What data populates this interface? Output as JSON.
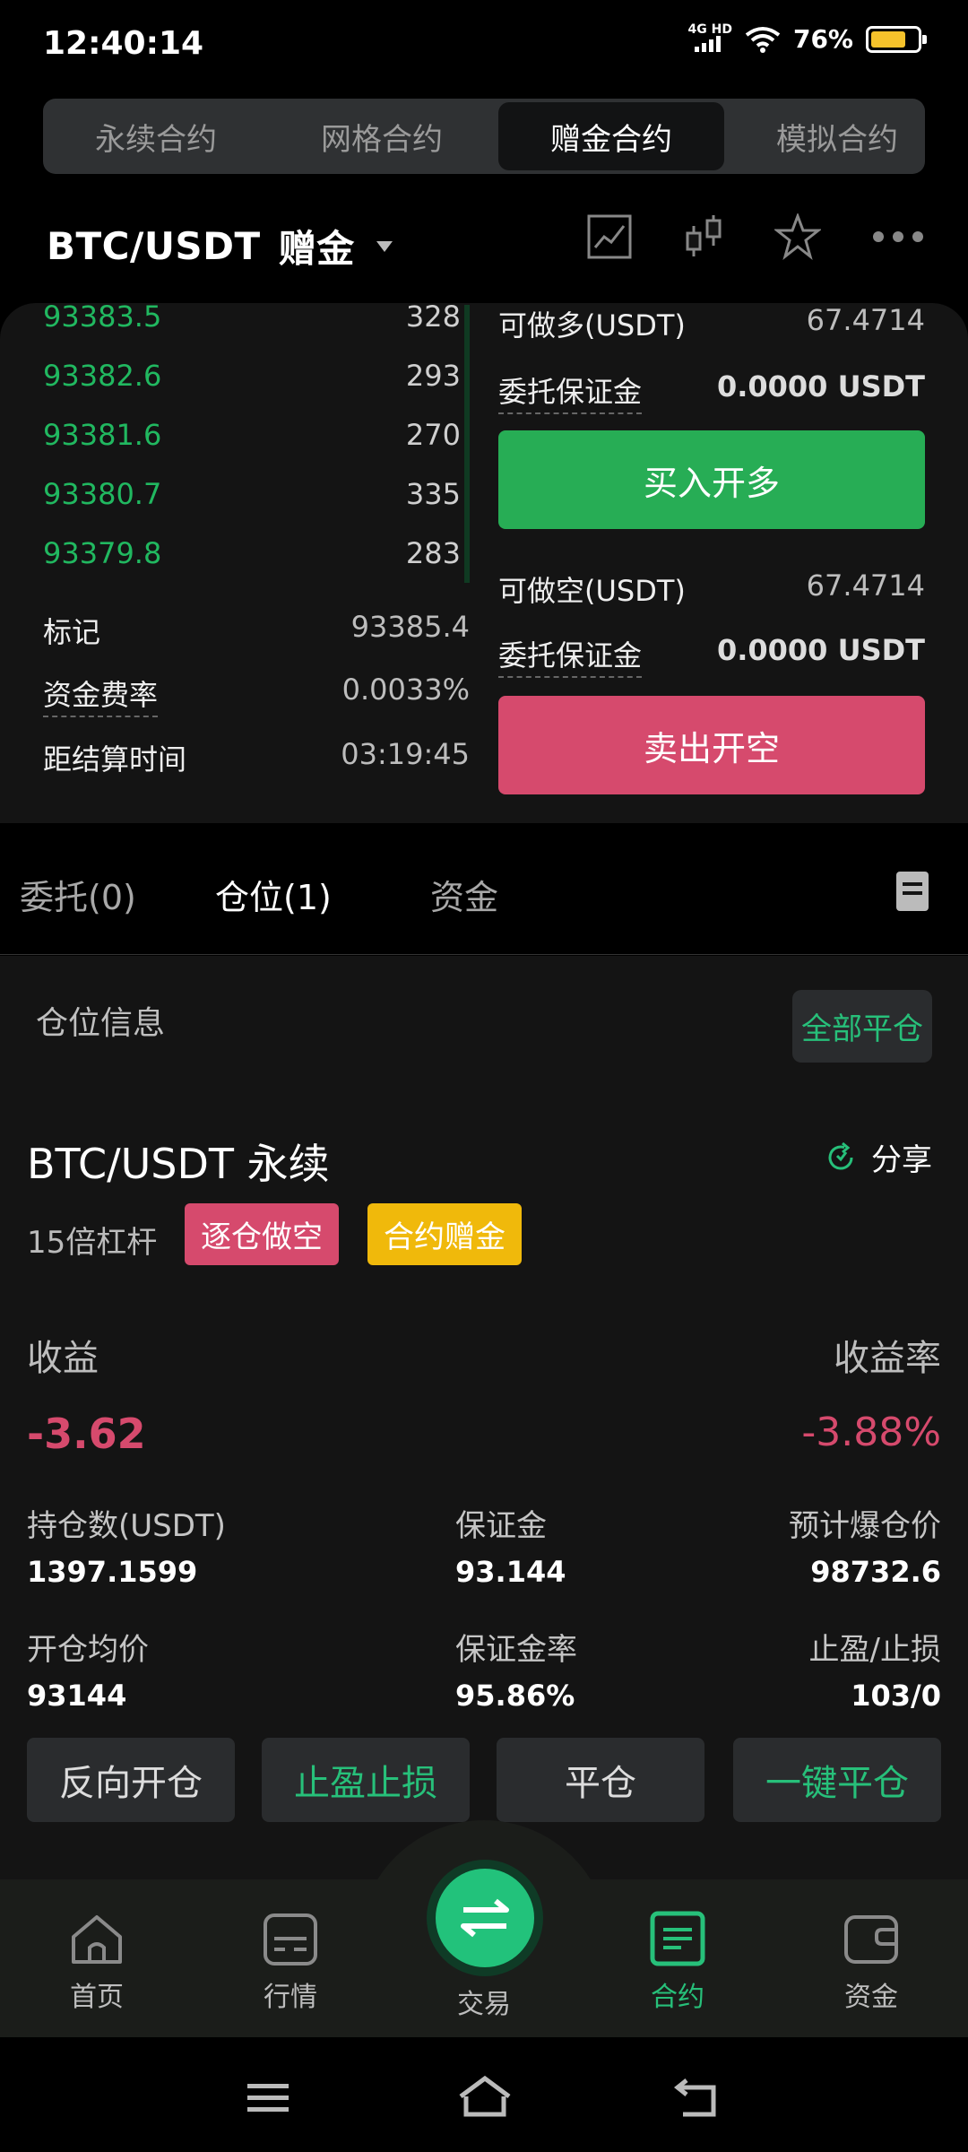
{
  "status": {
    "time": "12:40:14",
    "network_top": "4G HD",
    "battery": "76%",
    "battery_level": 0.76
  },
  "top_tabs": [
    {
      "label": "永续合约"
    },
    {
      "label": "网格合约"
    },
    {
      "label": "赠金合约"
    },
    {
      "label": "模拟合约"
    }
  ],
  "header": {
    "pair": "BTC/USDT",
    "mode": "赠金"
  },
  "orderbook": {
    "rows": [
      {
        "price": "93383.5",
        "size": "328"
      },
      {
        "price": "93382.6",
        "size": "293"
      },
      {
        "price": "93381.6",
        "size": "270"
      },
      {
        "price": "93380.7",
        "size": "335"
      },
      {
        "price": "93379.8",
        "size": "283"
      }
    ],
    "mark_label": "标记",
    "mark_value": "93385.4",
    "funding_label": "资金费率",
    "funding_value": "0.0033%",
    "settle_label": "距结算时间",
    "settle_value": "03:19:45"
  },
  "trade_panel": {
    "long_avail_label": "可做多(USDT)",
    "long_avail_value": "67.4714",
    "margin_label": "委托保证金",
    "margin_value": "0.0000 USDT",
    "buy_label": "买入开多",
    "short_avail_label": "可做空(USDT)",
    "short_avail_value": "67.4714",
    "margin2_label": "委托保证金",
    "margin2_value": "0.0000 USDT",
    "sell_label": "卖出开空"
  },
  "position_tabs": [
    {
      "label": "委托(0)"
    },
    {
      "label": "仓位(1)"
    },
    {
      "label": "资金"
    }
  ],
  "position": {
    "section_title": "仓位信息",
    "close_all": "全部平仓",
    "symbol": "BTC/USDT 永续",
    "share": "分享",
    "leverage": "15倍杠杆",
    "badge_mode": "逐仓做空",
    "badge_bonus": "合约赠金",
    "pnl_label": "收益",
    "pnl_value": "-3.62",
    "roe_label": "收益率",
    "roe_value": "-3.88%",
    "stats": [
      {
        "label": "持仓数(USDT)",
        "value": "1397.1599"
      },
      {
        "label": "保证金",
        "value": "93.144"
      },
      {
        "label": "预计爆仓价",
        "value": "98732.6"
      },
      {
        "label": "开仓均价",
        "value": "93144"
      },
      {
        "label": "保证金率",
        "value": "95.86%"
      },
      {
        "label": "止盈/止损",
        "value": "103/0"
      }
    ],
    "actions": [
      {
        "label": "反向开仓"
      },
      {
        "label": "止盈止损"
      },
      {
        "label": "平仓"
      },
      {
        "label": "一键平仓"
      }
    ]
  },
  "nav": [
    {
      "label": "首页",
      "icon": "home-icon"
    },
    {
      "label": "行情",
      "icon": "market-icon"
    },
    {
      "label": "交易",
      "icon": "swap-icon"
    },
    {
      "label": "合约",
      "icon": "contract-icon"
    },
    {
      "label": "资金",
      "icon": "wallet-icon"
    }
  ],
  "colors": {
    "green": "#27ad55",
    "red": "#d64a6d",
    "yellow": "#f0b90b",
    "accent": "#27c07a"
  }
}
